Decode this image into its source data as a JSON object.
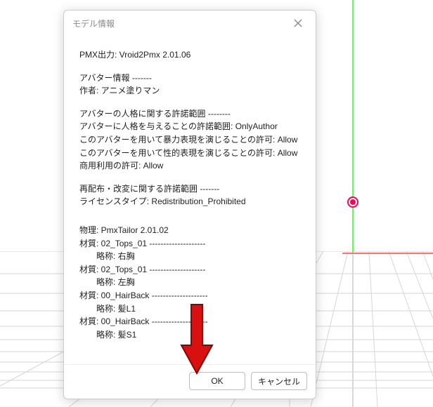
{
  "dialog": {
    "title": "モデル情報",
    "buttons": {
      "ok": "OK",
      "cancel": "キャンセル"
    }
  },
  "info": {
    "pmx_output": "PMX出力: Vroid2Pmx 2.01.06",
    "avatar_header": "アバター情報 -------",
    "author": "作者: アニメ塗りマン",
    "persona_header": "アバターの人格に関する許諾範囲 --------",
    "persona_give": "アバターに人格を与えることの許諾範囲: OnlyAuthor",
    "violent": "このアバターを用いて暴力表現を演じることの許可: Allow",
    "sexual": "このアバターを用いて性的表現を演じることの許可: Allow",
    "commercial": "商用利用の許可: Allow",
    "redist_header": "再配布・改変に関する許諾範囲 -------",
    "license_type": "ライセンスタイプ: Redistribution_Prohibited",
    "physics": "物理: PmxTailor 2.01.02",
    "mat1": "材質: 02_Tops_01 --------------------",
    "mat1_abbr": "略称: 右胸",
    "mat2": "材質: 02_Tops_01 --------------------",
    "mat2_abbr": "略称: 左胸",
    "mat3": "材質: 00_HairBack --------------------",
    "mat3_abbr": "略称: 髪L1",
    "mat4": "材質: 00_HairBack --------------------",
    "mat4_abbr": "略称: 髪S1"
  }
}
